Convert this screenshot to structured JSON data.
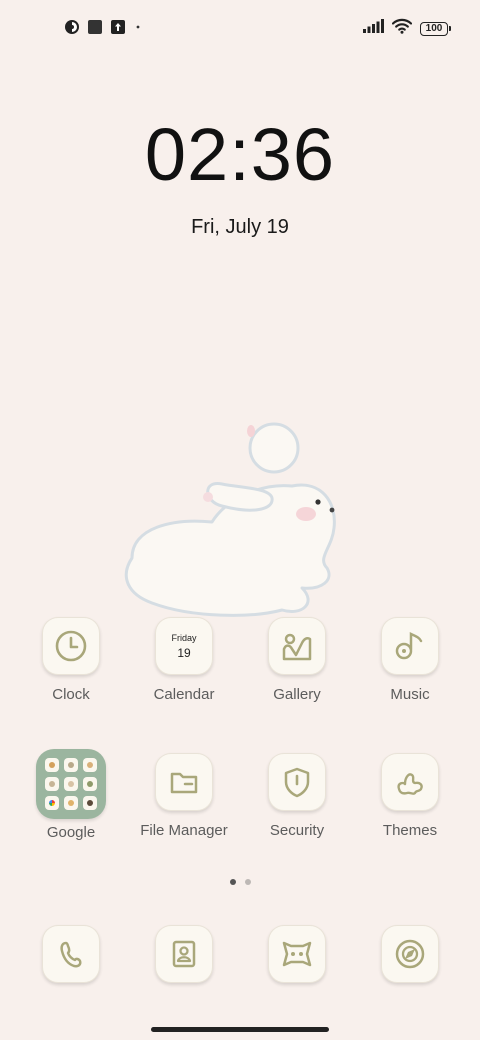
{
  "status_bar": {
    "left_icons": [
      "photo-camera-icon",
      "square-app-icon",
      "upload-arrow-icon"
    ],
    "battery": "100"
  },
  "lockscreen": {
    "time": "02:36",
    "date": "Fri, July 19"
  },
  "apps_row1": [
    {
      "label": "Clock",
      "icon": "clock-icon"
    },
    {
      "label": "Calendar",
      "icon": "calendar-icon",
      "day": "Friday",
      "date": "19"
    },
    {
      "label": "Gallery",
      "icon": "gallery-icon"
    },
    {
      "label": "Music",
      "icon": "music-icon"
    }
  ],
  "apps_row2": [
    {
      "label": "Google",
      "icon": "google-folder-icon"
    },
    {
      "label": "File Manager",
      "icon": "folder-icon"
    },
    {
      "label": "Security",
      "icon": "shield-icon"
    },
    {
      "label": "Themes",
      "icon": "themes-icon"
    }
  ],
  "dock": [
    {
      "icon": "phone-icon"
    },
    {
      "icon": "contacts-icon"
    },
    {
      "icon": "messaging-icon"
    },
    {
      "icon": "browser-icon"
    }
  ],
  "pager": {
    "pages": 2,
    "active": 1
  },
  "colors": {
    "background": "#f8f0ec",
    "tile": "#fbf8f1",
    "icon_stroke": "#a9a77a",
    "folder": "#9bb59f"
  }
}
